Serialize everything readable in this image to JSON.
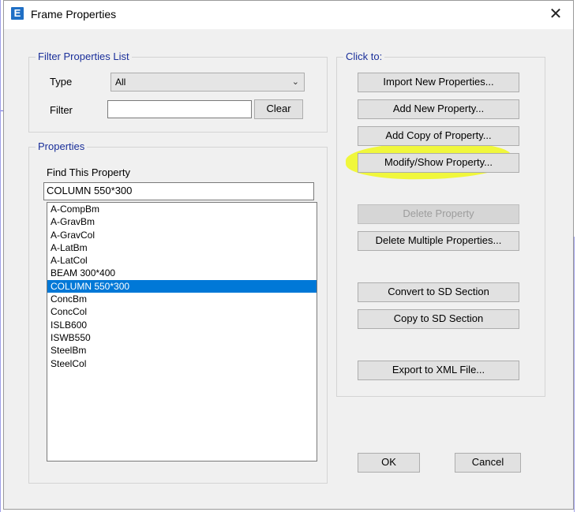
{
  "window": {
    "title": "Frame Properties",
    "icon_letter": "E",
    "close_glyph": "✕"
  },
  "filter_group": {
    "title": "Filter Properties List",
    "type_label": "Type",
    "type_value": "All",
    "filter_label": "Filter",
    "filter_value": "",
    "clear_label": "Clear"
  },
  "properties_group": {
    "title": "Properties",
    "find_label": "Find This Property",
    "find_value": "COLUMN 550*300",
    "items": [
      {
        "label": "A-CompBm",
        "selected": false
      },
      {
        "label": "A-GravBm",
        "selected": false
      },
      {
        "label": "A-GravCol",
        "selected": false
      },
      {
        "label": "A-LatBm",
        "selected": false
      },
      {
        "label": "A-LatCol",
        "selected": false
      },
      {
        "label": "BEAM 300*400",
        "selected": false
      },
      {
        "label": "COLUMN 550*300",
        "selected": true
      },
      {
        "label": "ConcBm",
        "selected": false
      },
      {
        "label": "ConcCol",
        "selected": false
      },
      {
        "label": "ISLB600",
        "selected": false
      },
      {
        "label": "ISWB550",
        "selected": false
      },
      {
        "label": "SteelBm",
        "selected": false
      },
      {
        "label": "SteelCol",
        "selected": false
      }
    ]
  },
  "click_group": {
    "title": "Click to:",
    "import_label": "Import New Properties...",
    "add_new_label": "Add New Property...",
    "add_copy_label": "Add Copy of Property...",
    "modify_label": "Modify/Show Property...",
    "delete_label": "Delete Property",
    "delete_multiple_label": "Delete Multiple Properties...",
    "convert_sd_label": "Convert to SD Section",
    "copy_sd_label": "Copy to SD Section",
    "export_xml_label": "Export to XML File..."
  },
  "footer": {
    "ok_label": "OK",
    "cancel_label": "Cancel"
  },
  "colors": {
    "group_title": "#1a2f9a",
    "selection": "#0078d7",
    "highlight": "#f0fa00"
  }
}
